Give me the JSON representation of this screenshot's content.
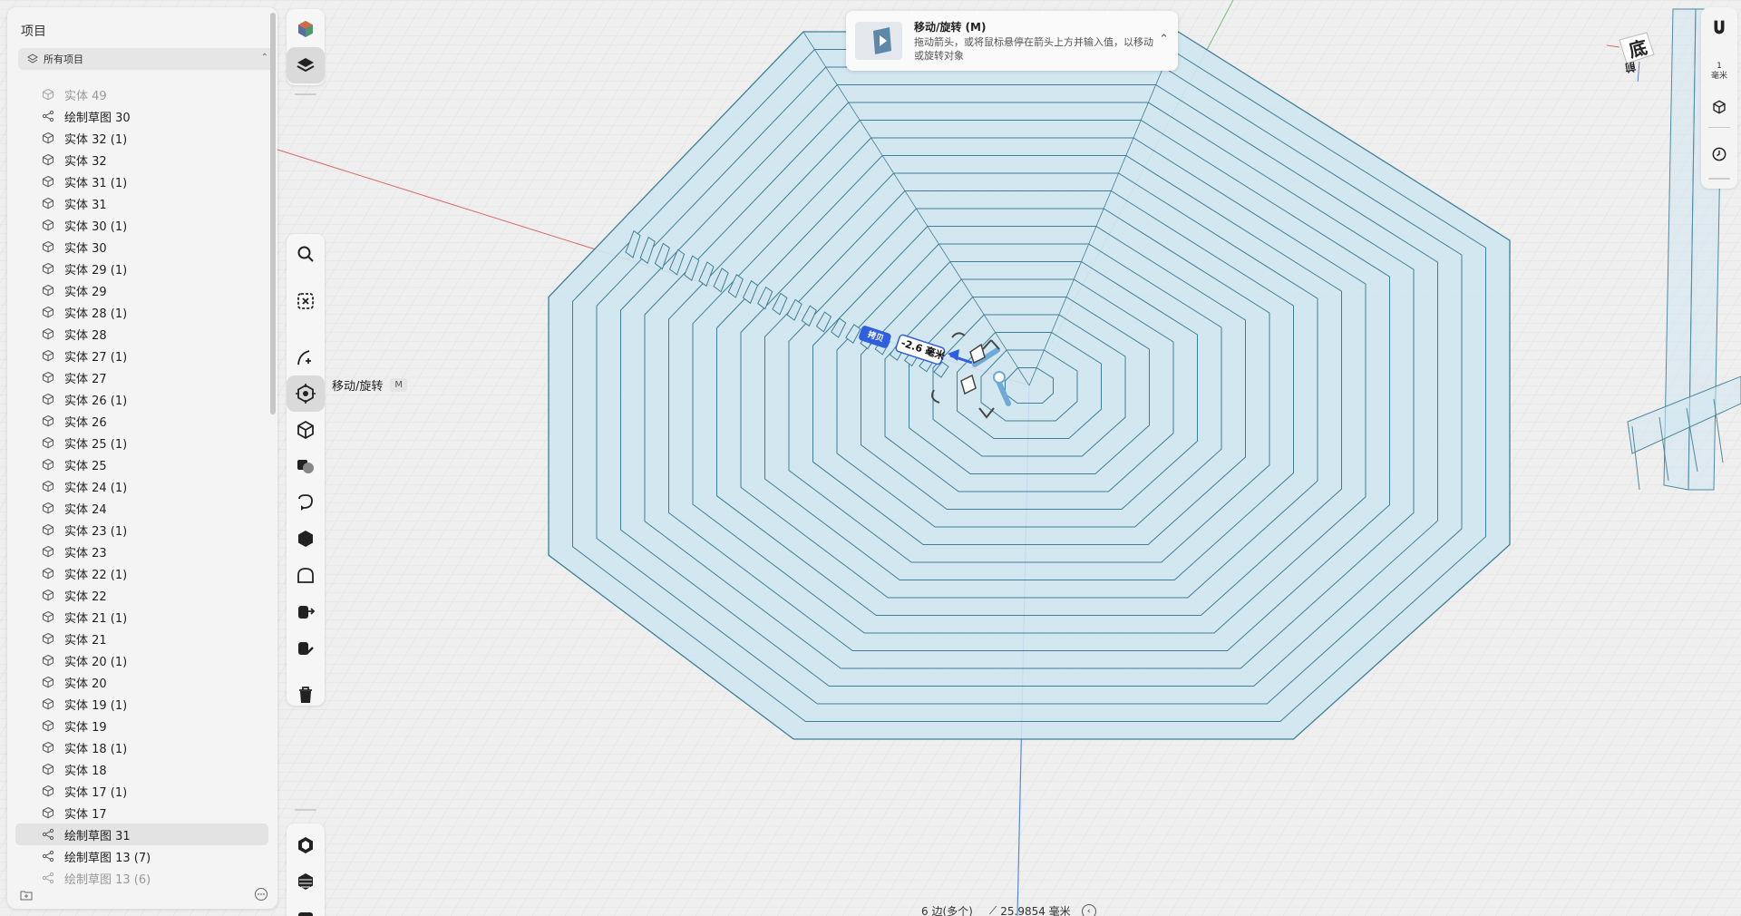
{
  "panel": {
    "title": "项目",
    "filter_label": "所有项目",
    "items": [
      {
        "label": "实体 49",
        "type": "solid",
        "dim": true
      },
      {
        "label": "绘制草图 30",
        "type": "sketch"
      },
      {
        "label": "实体 32 (1)",
        "type": "solid"
      },
      {
        "label": "实体 32",
        "type": "solid"
      },
      {
        "label": "实体 31 (1)",
        "type": "solid"
      },
      {
        "label": "实体 31",
        "type": "solid"
      },
      {
        "label": "实体 30 (1)",
        "type": "solid"
      },
      {
        "label": "实体 30",
        "type": "solid"
      },
      {
        "label": "实体 29 (1)",
        "type": "solid"
      },
      {
        "label": "实体 29",
        "type": "solid"
      },
      {
        "label": "实体 28 (1)",
        "type": "solid"
      },
      {
        "label": "实体 28",
        "type": "solid"
      },
      {
        "label": "实体 27 (1)",
        "type": "solid"
      },
      {
        "label": "实体 27",
        "type": "solid"
      },
      {
        "label": "实体 26 (1)",
        "type": "solid"
      },
      {
        "label": "实体 26",
        "type": "solid"
      },
      {
        "label": "实体 25 (1)",
        "type": "solid"
      },
      {
        "label": "实体 25",
        "type": "solid"
      },
      {
        "label": "实体 24 (1)",
        "type": "solid"
      },
      {
        "label": "实体 24",
        "type": "solid"
      },
      {
        "label": "实体 23 (1)",
        "type": "solid"
      },
      {
        "label": "实体 23",
        "type": "solid"
      },
      {
        "label": "实体 22 (1)",
        "type": "solid"
      },
      {
        "label": "实体 22",
        "type": "solid"
      },
      {
        "label": "实体 21 (1)",
        "type": "solid"
      },
      {
        "label": "实体 21",
        "type": "solid"
      },
      {
        "label": "实体 20 (1)",
        "type": "solid"
      },
      {
        "label": "实体 20",
        "type": "solid"
      },
      {
        "label": "实体 19 (1)",
        "type": "solid"
      },
      {
        "label": "实体 19",
        "type": "solid"
      },
      {
        "label": "实体 18 (1)",
        "type": "solid"
      },
      {
        "label": "实体 18",
        "type": "solid"
      },
      {
        "label": "实体 17 (1)",
        "type": "solid"
      },
      {
        "label": "实体 17",
        "type": "solid"
      },
      {
        "label": "绘制草图 31",
        "type": "sketch",
        "selected": true
      },
      {
        "label": "绘制草图 13 (7)",
        "type": "sketch"
      },
      {
        "label": "绘制草图 13 (6)",
        "type": "sketch",
        "dim": true
      }
    ]
  },
  "toolbar": {
    "tooltip_label": "移动/旋转",
    "tooltip_key": "M",
    "icons": [
      "appearance-icon",
      "layers-icon",
      "search-icon",
      "deselect-icon",
      "sketch-icon",
      "move-rotate-icon",
      "primitive-icon",
      "boolean-icon",
      "revolve-icon",
      "solid-icon",
      "fillet-icon",
      "export-icon",
      "edit-icon",
      "delete-icon",
      "material-icon",
      "hatch-icon",
      "print-icon"
    ]
  },
  "notice": {
    "title": "移动/旋转 (M)",
    "description": "拖动箭头，或将鼠标悬停在箭头上方并输入值，以移动或旋转对象"
  },
  "right_tools": {
    "unit_value": "1",
    "unit_label": "毫米",
    "icons": [
      "magnet-icon",
      "view-cube-icon",
      "history-icon"
    ]
  },
  "viewcube": {
    "face_label": "底",
    "face_label_2": "前"
  },
  "gizmo": {
    "copy_label": "拷贝",
    "distance_value": "-2.6 毫米"
  },
  "status": {
    "edges": "6 边(多个)",
    "length": "25.9854 毫米",
    "clock_label": "‹"
  },
  "colors": {
    "accent": "#2f5fe0",
    "shape_fill": "#cfe6f0",
    "shape_stroke": "#3f7f96",
    "grid_minor": "#dcdcdc",
    "grid_major": "#cdcdcd"
  }
}
